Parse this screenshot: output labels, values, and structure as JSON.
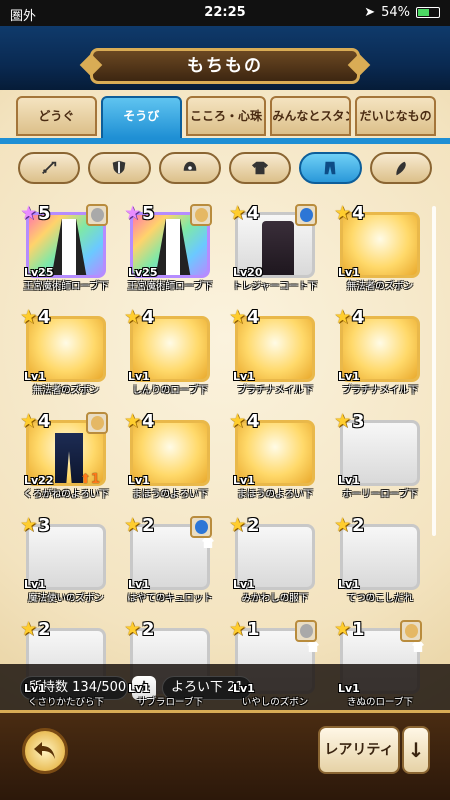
{
  "status": {
    "carrier": "圏外",
    "time": "22:25",
    "battery": "54%",
    "battery_level": 0.54
  },
  "header": {
    "title": "もちもの"
  },
  "tabs": [
    {
      "label": "どうぐ",
      "active": false
    },
    {
      "label": "そうび",
      "active": true
    },
    {
      "label": "こころ・心珠",
      "active": false
    },
    {
      "label": "みんなとスタンプ",
      "active": false
    },
    {
      "label": "だいじなもの",
      "active": false
    }
  ],
  "filters": [
    {
      "icon": "sword-icon",
      "active": false
    },
    {
      "icon": "shield-icon",
      "active": false
    },
    {
      "icon": "helmet-icon",
      "active": false
    },
    {
      "icon": "shirt-icon",
      "active": false
    },
    {
      "icon": "pants-icon",
      "active": true
    },
    {
      "icon": "accessory-icon",
      "active": false
    }
  ],
  "items": [
    {
      "rarity": "5",
      "level": "Lv25",
      "name": "王宮魔術師ローブ下",
      "avatar": "gray",
      "art": "rainbow robe"
    },
    {
      "rarity": "5",
      "level": "Lv25",
      "name": "王宮魔術師ローブ下",
      "avatar": "blond",
      "art": "rainbow robe"
    },
    {
      "rarity": "4",
      "level": "Lv20",
      "name": "トレジャーコート下",
      "avatar": "blue",
      "art": "gray coat"
    },
    {
      "rarity": "4",
      "level": "Lv1",
      "name": "無法者のズボン",
      "avatar": "",
      "art": "gold"
    },
    {
      "rarity": "4",
      "level": "Lv1",
      "name": "無法者のズボン",
      "avatar": "",
      "art": "gold"
    },
    {
      "rarity": "4",
      "level": "Lv1",
      "name": "しんりのローブ下",
      "avatar": "",
      "art": "gold"
    },
    {
      "rarity": "4",
      "level": "Lv1",
      "name": "プラチナメイル下",
      "avatar": "",
      "art": "gold"
    },
    {
      "rarity": "4",
      "level": "Lv1",
      "name": "プラチナメイル下",
      "avatar": "",
      "art": "gold"
    },
    {
      "rarity": "4",
      "level": "Lv22",
      "name": "くろがねのよろい下",
      "avatar": "blond",
      "art": "gold pants",
      "upgrade": "1"
    },
    {
      "rarity": "4",
      "level": "Lv1",
      "name": "まほうのよろい下",
      "avatar": "",
      "art": "gold"
    },
    {
      "rarity": "4",
      "level": "Lv1",
      "name": "まほうのよろい下",
      "avatar": "",
      "art": "gold"
    },
    {
      "rarity": "3",
      "level": "Lv1",
      "name": "ホーリーローブ下",
      "avatar": "",
      "art": "gray"
    },
    {
      "rarity": "3",
      "level": "Lv1",
      "name": "魔法使いのズボン",
      "avatar": "",
      "art": "gray"
    },
    {
      "rarity": "2",
      "level": "Lv1",
      "name": "はやてのキュロット",
      "avatar": "blue",
      "shirt": true,
      "art": "gray"
    },
    {
      "rarity": "2",
      "level": "Lv1",
      "name": "みかわしの服下",
      "avatar": "",
      "art": "gray"
    },
    {
      "rarity": "2",
      "level": "Lv1",
      "name": "てつのこしだれ",
      "avatar": "",
      "art": "gray"
    },
    {
      "rarity": "2",
      "level": "Lv1",
      "name": "くさりかたびら下",
      "avatar": "",
      "art": "gray"
    },
    {
      "rarity": "2",
      "level": "Lv1",
      "name": "サブラローブ下",
      "avatar": "",
      "art": "gray"
    },
    {
      "rarity": "1",
      "level": "Lv1",
      "name": "いやしのズボン",
      "avatar": "gray",
      "shirt": true,
      "art": "gray"
    },
    {
      "rarity": "1",
      "level": "Lv1",
      "name": "きぬのローブ下",
      "avatar": "blond",
      "shirt": true,
      "art": "gray"
    }
  ],
  "inventory": {
    "count_label": "所持数",
    "count": "134/500",
    "category": "よろい下",
    "category_count": "21"
  },
  "footer": {
    "sort_label": "レアリティ",
    "order_label": "↓"
  }
}
